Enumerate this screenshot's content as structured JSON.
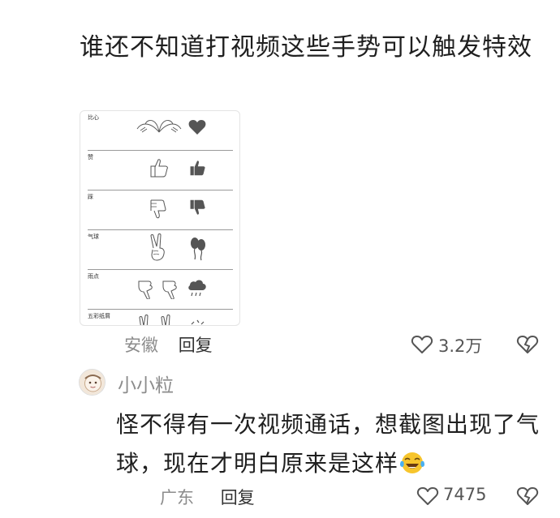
{
  "comment1": {
    "text": "谁还不知道打视频这些手势可以触发特效",
    "location": "安徽",
    "reply_label": "回复",
    "like_count": "3.2万"
  },
  "gesture_card": {
    "rows": [
      {
        "label": "比心",
        "hand_icon": "heart-hands-icon",
        "effect_icon": "heart-icon"
      },
      {
        "label": "赞",
        "hand_icon": "thumbs-up-outline-icon",
        "effect_icon": "thumbs-up-icon"
      },
      {
        "label": "踩",
        "hand_icon": "thumbs-down-outline-icon",
        "effect_icon": "thumbs-down-icon"
      },
      {
        "label": "气球",
        "hand_icon": "victory-hands-icon",
        "effect_icon": "balloon-icon"
      },
      {
        "label": "雨点",
        "hand_icon": "pointing-down-hands-icon",
        "effect_icon": "rain-cloud-icon"
      },
      {
        "label": "五彩纸屑",
        "hand_icon": "victory-hands-icon",
        "effect_icon": "confetti-icon"
      }
    ]
  },
  "comment2": {
    "username": "小小粒",
    "text": "怪不得有一次视频通话，想截图出现了气球，现在才明白原来是这样",
    "emoji": "tears-of-joy-emoji",
    "location": "广东",
    "reply_label": "回复",
    "like_count": "7475"
  },
  "colors": {
    "text": "#1f1f1f",
    "meta": "#8c8c8c",
    "icon": "#555555"
  }
}
